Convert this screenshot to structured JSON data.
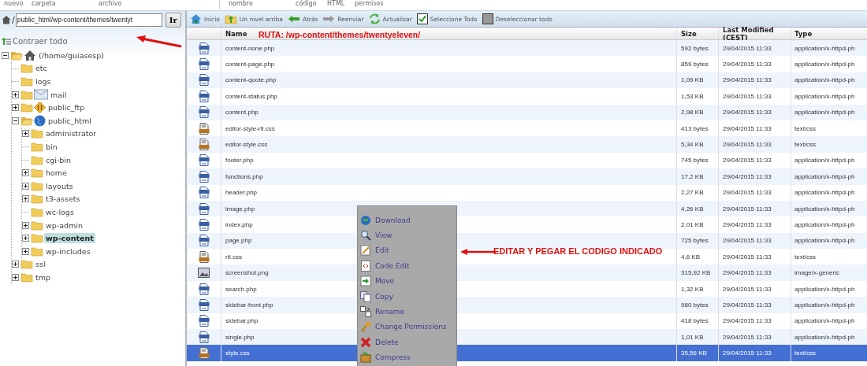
{
  "top_toolbar_labels": [
    "nuevo",
    "carpeta",
    "archivo",
    "nombre",
    "código",
    "HTML",
    "permisos"
  ],
  "path_bar": {
    "prefix": "/",
    "value": "public_html/wp-content/themes/twentyt",
    "go_button": "Ir"
  },
  "tree": {
    "collapse_all": "Contraer todo",
    "items": [
      {
        "label": "(/home/guiasesp)",
        "kind": "home",
        "expanded": true,
        "selected": false,
        "children": [
          {
            "label": "etc",
            "kind": "folder",
            "expanded": false,
            "selected": false,
            "has_toggle": false
          },
          {
            "label": "logs",
            "kind": "folder",
            "expanded": false,
            "selected": false,
            "has_toggle": false
          },
          {
            "label": "mail",
            "kind": "mail",
            "expanded": false,
            "selected": false,
            "has_toggle": true
          },
          {
            "label": "public_ftp",
            "kind": "ftp",
            "expanded": false,
            "selected": false,
            "has_toggle": true
          },
          {
            "label": "public_html",
            "kind": "web",
            "expanded": true,
            "selected": false,
            "has_toggle": true,
            "children": [
              {
                "label": "administrator",
                "kind": "folder",
                "expanded": false,
                "selected": false,
                "has_toggle": true
              },
              {
                "label": "bin",
                "kind": "folder",
                "expanded": false,
                "selected": false,
                "has_toggle": false
              },
              {
                "label": "cgi-bin",
                "kind": "folder",
                "expanded": false,
                "selected": false,
                "has_toggle": false
              },
              {
                "label": "home",
                "kind": "folder",
                "expanded": false,
                "selected": false,
                "has_toggle": true
              },
              {
                "label": "layouts",
                "kind": "folder",
                "expanded": false,
                "selected": false,
                "has_toggle": true
              },
              {
                "label": "t3-assets",
                "kind": "folder",
                "expanded": false,
                "selected": false,
                "has_toggle": true
              },
              {
                "label": "wc-logs",
                "kind": "folder",
                "expanded": false,
                "selected": false,
                "has_toggle": false
              },
              {
                "label": "wp-admin",
                "kind": "folder",
                "expanded": false,
                "selected": false,
                "has_toggle": true
              },
              {
                "label": "wp-content",
                "kind": "folder",
                "expanded": false,
                "selected": true,
                "has_toggle": true
              },
              {
                "label": "wp-includes",
                "kind": "folder",
                "expanded": false,
                "selected": false,
                "has_toggle": true
              }
            ]
          },
          {
            "label": "ssl",
            "kind": "folder",
            "expanded": false,
            "selected": false,
            "has_toggle": true
          },
          {
            "label": "tmp",
            "kind": "folder",
            "expanded": false,
            "selected": false,
            "has_toggle": true
          }
        ],
        "has_toggle": true
      }
    ]
  },
  "toolbar": [
    {
      "label": "Inicio",
      "kind": "home"
    },
    {
      "label": "Un nivel arriba",
      "kind": "up"
    },
    {
      "label": "Atrás",
      "kind": "back"
    },
    {
      "label": "Reenviar",
      "kind": "forward"
    },
    {
      "label": "Actualizar",
      "kind": "refresh"
    },
    {
      "label": "Seleccione Todo",
      "kind": "select-all"
    },
    {
      "label": "Deseleccionar todo",
      "kind": "deselect-all"
    }
  ],
  "table": {
    "columns": [
      "Name",
      "Size",
      "Last Modified (CEST)",
      "Type"
    ],
    "rows": [
      {
        "kind": "php",
        "name": "content-none.php",
        "size": "592 bytes",
        "modified": "29/04/2015 11:33",
        "type": "application/x-httpd-ph",
        "selected": false
      },
      {
        "kind": "php",
        "name": "content-page.php",
        "size": "859 bytes",
        "modified": "29/04/2015 11:33",
        "type": "application/x-httpd-ph",
        "selected": false
      },
      {
        "kind": "php",
        "name": "content-quote.php",
        "size": "1,09 KB",
        "modified": "29/04/2015 11:33",
        "type": "application/x-httpd-ph",
        "selected": false
      },
      {
        "kind": "php",
        "name": "content-status.php",
        "size": "1,53 KB",
        "modified": "29/04/2015 11:33",
        "type": "application/x-httpd-ph",
        "selected": false
      },
      {
        "kind": "php",
        "name": "content.php",
        "size": "2,98 KB",
        "modified": "29/04/2015 11:33",
        "type": "application/x-httpd-ph",
        "selected": false
      },
      {
        "kind": "css",
        "name": "editor-style-rtl.css",
        "size": "413 bytes",
        "modified": "29/04/2015 11:33",
        "type": "text/css",
        "selected": false
      },
      {
        "kind": "css",
        "name": "editor-style.css",
        "size": "5,34 KB",
        "modified": "29/04/2015 11:33",
        "type": "text/css",
        "selected": false
      },
      {
        "kind": "php",
        "name": "footer.php",
        "size": "745 bytes",
        "modified": "29/04/2015 11:33",
        "type": "application/x-httpd-ph",
        "selected": false
      },
      {
        "kind": "php",
        "name": "functions.php",
        "size": "17,2 KB",
        "modified": "29/04/2015 11:33",
        "type": "application/x-httpd-ph",
        "selected": false
      },
      {
        "kind": "php",
        "name": "header.php",
        "size": "2,27 KB",
        "modified": "29/04/2015 11:33",
        "type": "application/x-httpd-ph",
        "selected": false
      },
      {
        "kind": "php",
        "name": "image.php",
        "size": "4,26 KB",
        "modified": "29/04/2015 11:33",
        "type": "application/x-httpd-ph",
        "selected": false
      },
      {
        "kind": "php",
        "name": "index.php",
        "size": "2,01 KB",
        "modified": "29/04/2015 11:33",
        "type": "application/x-httpd-ph",
        "selected": false
      },
      {
        "kind": "php",
        "name": "page.php",
        "size": "725 bytes",
        "modified": "29/04/2015 11:33",
        "type": "application/x-httpd-ph",
        "selected": false
      },
      {
        "kind": "css",
        "name": "rtl.css",
        "size": "4,6 KB",
        "modified": "29/04/2015 11:33",
        "type": "text/css",
        "selected": false
      },
      {
        "kind": "png",
        "name": "screenshot.png",
        "size": "315,92 KB",
        "modified": "29/04/2015 11:33",
        "type": "image/x-generic",
        "selected": false
      },
      {
        "kind": "php",
        "name": "search.php",
        "size": "1,32 KB",
        "modified": "29/04/2015 11:33",
        "type": "application/x-httpd-ph",
        "selected": false
      },
      {
        "kind": "php",
        "name": "sidebar-front.php",
        "size": "980 bytes",
        "modified": "29/04/2015 11:33",
        "type": "application/x-httpd-ph",
        "selected": false
      },
      {
        "kind": "php",
        "name": "sidebar.php",
        "size": "418 bytes",
        "modified": "29/04/2015 11:33",
        "type": "application/x-httpd-ph",
        "selected": false
      },
      {
        "kind": "php",
        "name": "single.php",
        "size": "1,01 KB",
        "modified": "29/04/2015 11:33",
        "type": "application/x-httpd-ph",
        "selected": false
      },
      {
        "kind": "css",
        "name": "style.css",
        "size": "35,56 KB",
        "modified": "29/04/2015 11:33",
        "type": "text/css",
        "selected": true
      }
    ]
  },
  "context_menu": [
    {
      "label": "Download",
      "kind": "download"
    },
    {
      "label": "View",
      "kind": "view"
    },
    {
      "label": "Edit",
      "kind": "edit"
    },
    {
      "label": "Code Edit",
      "kind": "code-edit"
    },
    {
      "label": "Move",
      "kind": "move"
    },
    {
      "label": "Copy",
      "kind": "copy"
    },
    {
      "label": "Rename",
      "kind": "rename"
    },
    {
      "label": "Change Permissions",
      "kind": "permissions"
    },
    {
      "label": "Delete",
      "kind": "delete"
    },
    {
      "label": "Compress",
      "kind": "compress"
    }
  ],
  "annotations": [
    {
      "text": "RUTA: /wp-content/themes/twentyeleven/",
      "kind": "path"
    },
    {
      "text": "EDITAR Y PEGAR EL CODIGO INDICADO",
      "kind": "edit"
    }
  ]
}
